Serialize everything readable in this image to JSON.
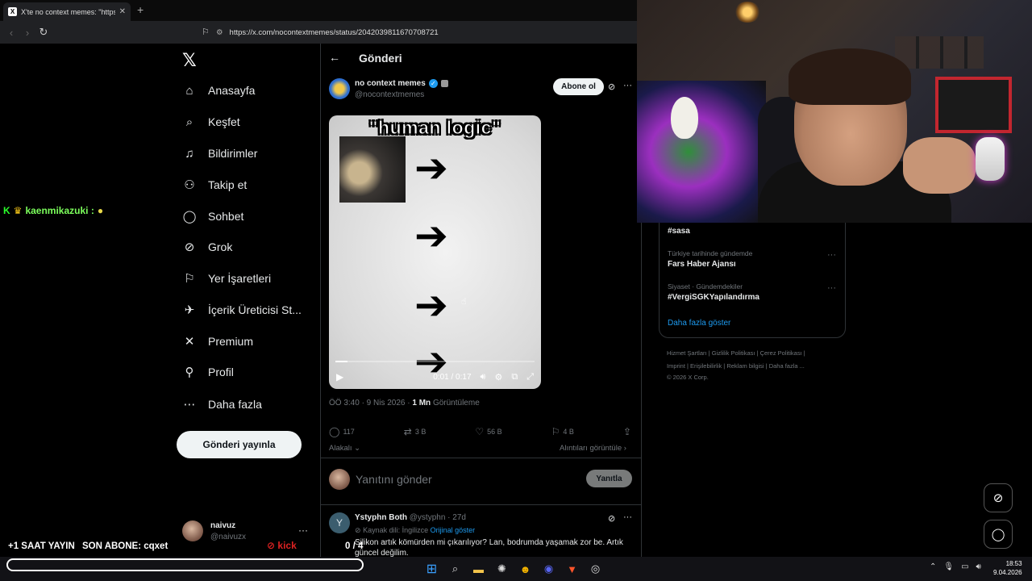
{
  "browser": {
    "tab_title": "X'te no context memes: \"https://",
    "url": "https://x.com/nocontextmemes/status/2042039811670708721"
  },
  "chat": {
    "username": "kaenmikazuki :"
  },
  "nav": {
    "items": [
      {
        "label": "Anasayfa",
        "icon": "home-icon"
      },
      {
        "label": "Keşfet",
        "icon": "search-icon"
      },
      {
        "label": "Bildirimler",
        "icon": "bell-icon"
      },
      {
        "label": "Takip et",
        "icon": "person-add-icon"
      },
      {
        "label": "Sohbet",
        "icon": "chat-icon"
      },
      {
        "label": "Grok",
        "icon": "grok-icon"
      },
      {
        "label": "Yer İşaretleri",
        "icon": "bookmark-icon"
      },
      {
        "label": "İçerik Üreticisi St...",
        "icon": "rocket-icon"
      },
      {
        "label": "Premium",
        "icon": "x-icon"
      },
      {
        "label": "Profil",
        "icon": "person-icon"
      },
      {
        "label": "Daha fazla",
        "icon": "more-circle-icon"
      }
    ],
    "post_button": "Gönderi yayınla",
    "me_name": "naivuz",
    "me_handle": "@naivuzx"
  },
  "post": {
    "header": "Gönderi",
    "author_name": "no context memes",
    "author_handle": "@nocontextmemes",
    "follow_label": "Abone ol",
    "video": {
      "caption": "\"human logic\"",
      "time": "0:01 / 0:17",
      "progress": 0.06
    },
    "time_meta": "ÖÖ 3:40 · 9 Nis 2026 · ",
    "views": "1 Mn",
    "views_label": " Görüntüleme",
    "replies": "117",
    "reposts": "3 B",
    "likes": "56 B",
    "bookmarks": "4 B",
    "related": "Alakalı",
    "quotes": "Alıntıları görüntüle",
    "reply_placeholder": "Yanıtını gönder",
    "reply_button": "Yanıtla"
  },
  "comment": {
    "name": "Ystyphn Both",
    "handle": "@ystyphn · 27d",
    "avatar_letter": "Y",
    "translated": "Kaynak dili: İngilizce",
    "original": "Orijinal göster",
    "text": "Silikon artık kömürden mi çıkarılıyor? Lan, bodrumda yaşamak zor be. Artık güncel değilim."
  },
  "trends": [
    {
      "context": "",
      "name": "#sasa"
    },
    {
      "context": "Türkiye tarihinde gündemde",
      "name": "Fars Haber Ajansı"
    },
    {
      "context": "Siyaset · Gündemdekiler",
      "name": "#VergiSGKYapılandırma"
    }
  ],
  "trends_show_more": "Daha fazla göster",
  "footer": {
    "line1": "Hizmet Şartları  |  Gizlilik Politikası  |  Çerez Politikası  |",
    "line2": "Imprint  |  Erişilebilirlik  |  Reklam bilgisi  |  Daha fazla ...",
    "line3": "© 2026 X Corp."
  },
  "overlay": {
    "stream_time": "+1 SAAT YAYIN",
    "last_sub": "SON ABONE: cqxet",
    "kick_label": "kick",
    "count": "0 / 4"
  },
  "taskbar": {
    "time": "18:53",
    "date": "9.04.2026"
  }
}
